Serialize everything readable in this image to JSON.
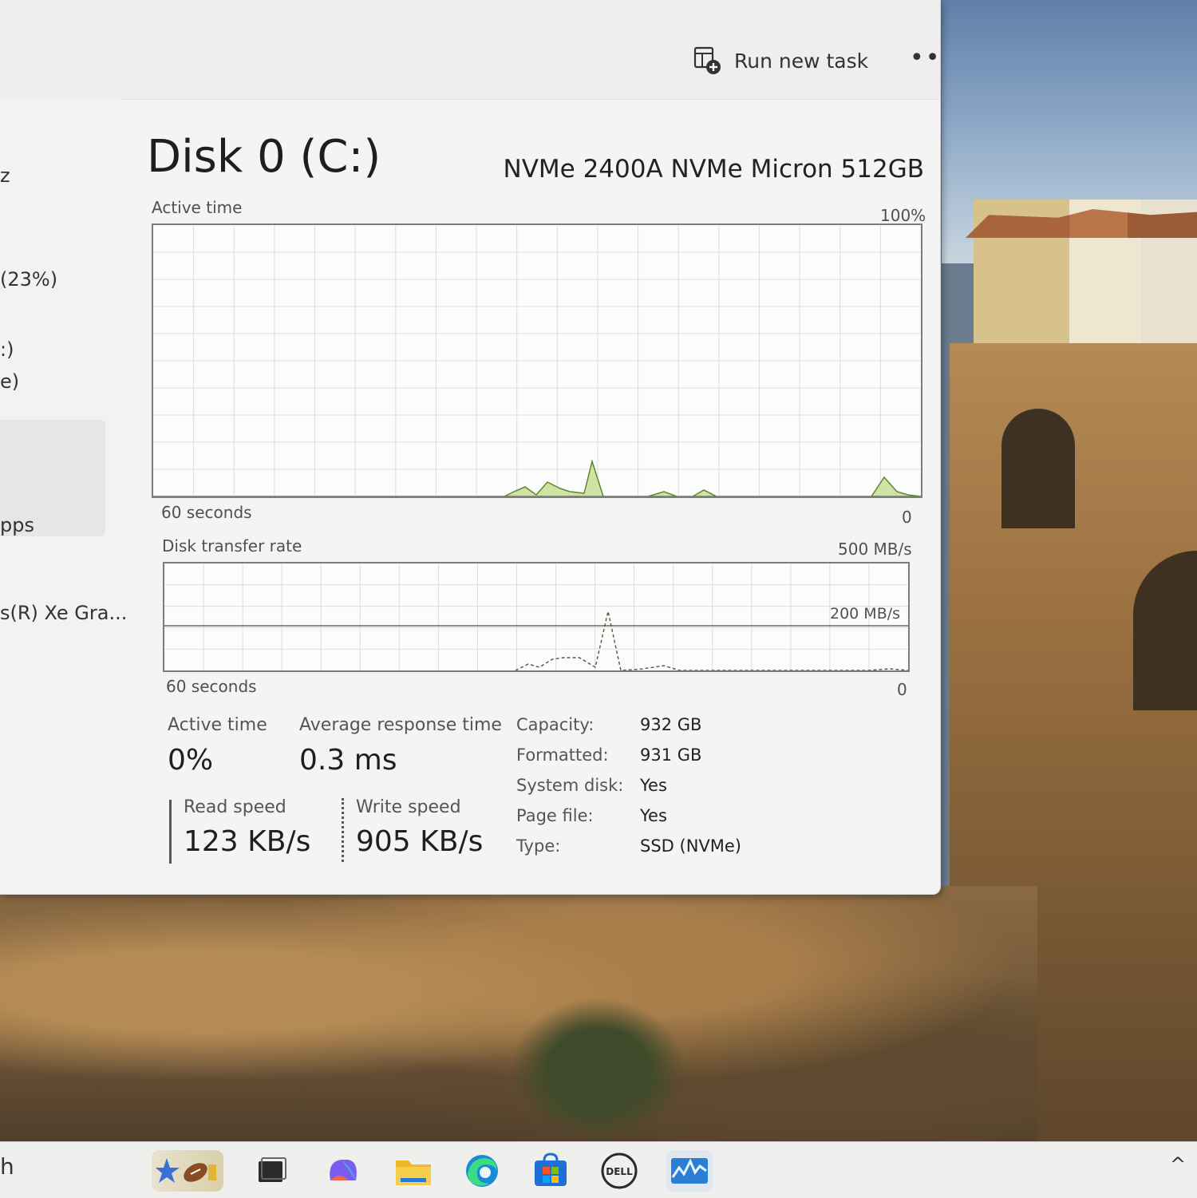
{
  "toolbar": {
    "run_new_task": "Run new task",
    "more": "•••"
  },
  "sidebar": {
    "items": [
      {
        "text": "z"
      },
      {
        "text": "(23%)"
      },
      {
        "text": ":)"
      },
      {
        "text": "e)"
      },
      {
        "text": "pps"
      },
      {
        "text": "s(R) Xe Gra..."
      }
    ]
  },
  "disk": {
    "title": "Disk 0 (C:)",
    "model": "NVMe 2400A NVMe Micron 512GB"
  },
  "active_graph": {
    "label": "Active time",
    "max_label": "100%",
    "time_label": "60 seconds",
    "min_label": "0"
  },
  "transfer_graph": {
    "label": "Disk transfer rate",
    "max_label": "500 MB/s",
    "mid_label": "200 MB/s",
    "time_label": "60 seconds",
    "min_label": "0"
  },
  "stats": {
    "active_time_label": "Active time",
    "active_time_value": "0%",
    "avg_response_label": "Average response time",
    "avg_response_value": "0.3 ms",
    "read_speed_label": "Read speed",
    "read_speed_value": "123 KB/s",
    "write_speed_label": "Write speed",
    "write_speed_value": "905 KB/s"
  },
  "properties": [
    {
      "label": "Capacity:",
      "value": "932 GB"
    },
    {
      "label": "Formatted:",
      "value": "931 GB"
    },
    {
      "label": "System disk:",
      "value": "Yes"
    },
    {
      "label": "Page file:",
      "value": "Yes"
    },
    {
      "label": "Type:",
      "value": "SSD (NVMe)"
    }
  ],
  "taskbar": {
    "search_fragment": "h",
    "icons": [
      "widgets-icon",
      "task-view-icon",
      "copilot-icon",
      "file-explorer-icon",
      "edge-icon",
      "store-icon",
      "dell-icon",
      "task-manager-icon"
    ],
    "tray_chevron": "^"
  },
  "colors": {
    "graph_line": "#5c8a2a",
    "graph_fill": "#cfe3a6",
    "graph_grid": "#d6e0d6"
  }
}
